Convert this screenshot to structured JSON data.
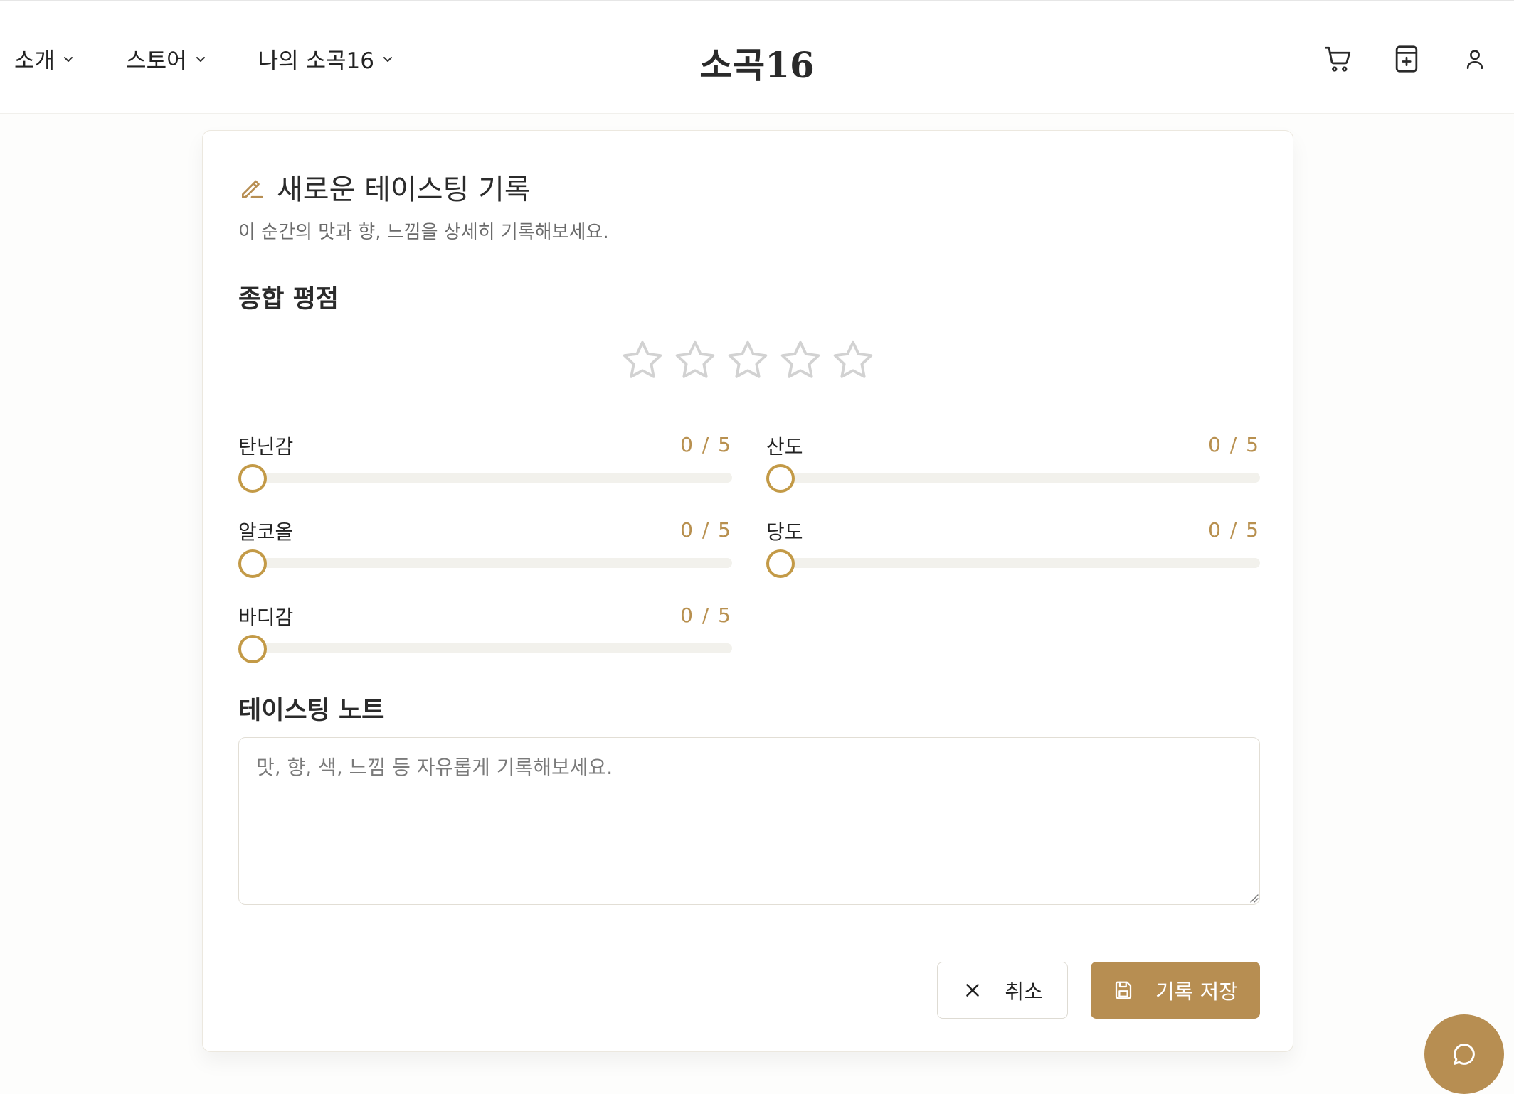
{
  "header": {
    "logo": "소곡16",
    "nav": [
      {
        "label": "소개"
      },
      {
        "label": "스토어"
      },
      {
        "label": "나의 소곡16"
      }
    ],
    "icons": [
      "cart-icon",
      "tasting-note-icon",
      "user-icon"
    ]
  },
  "form": {
    "title": "새로운 테이스팅 기록",
    "subtitle": "이 순간의 맛과 향, 느낌을 상세히 기록해보세요.",
    "rating": {
      "title": "종합 평점",
      "value": 0,
      "max": 5
    },
    "sliders": [
      {
        "label": "탄닌감",
        "value_text": "0 / 5",
        "value": 0,
        "max": 5
      },
      {
        "label": "산도",
        "value_text": "0 / 5",
        "value": 0,
        "max": 5
      },
      {
        "label": "알코올",
        "value_text": "0 / 5",
        "value": 0,
        "max": 5
      },
      {
        "label": "당도",
        "value_text": "0 / 5",
        "value": 0,
        "max": 5
      },
      {
        "label": "바디감",
        "value_text": "0 / 5",
        "value": 0,
        "max": 5
      }
    ],
    "notes": {
      "title": "테이스팅 노트",
      "placeholder": "맛, 향, 색, 느낌 등 자유롭게 기록해보세요.",
      "value": ""
    },
    "cancel_label": "취소",
    "save_label": "기록 저장"
  },
  "colors": {
    "accent": "#b78e52",
    "thumb_border": "#c39a47",
    "value_text": "#b8904f",
    "track": "#f2f1ec",
    "star_outline": "#d2d2d2"
  }
}
